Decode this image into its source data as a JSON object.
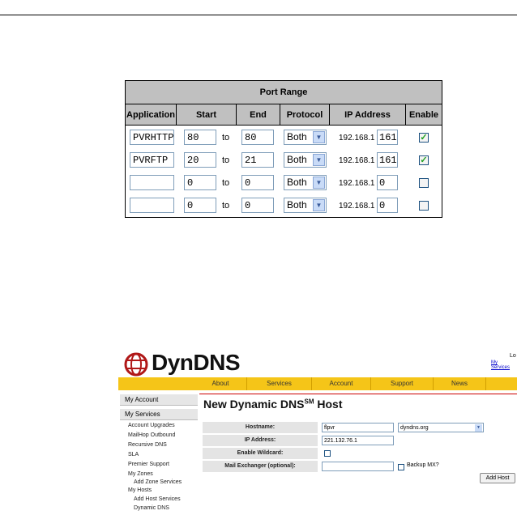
{
  "port_range": {
    "title": "Port Range",
    "columns": [
      "Application",
      "Start",
      "End",
      "Protocol",
      "IP Address",
      "Enable"
    ],
    "to_label": "to",
    "rows": [
      {
        "application": "PVRHTTP",
        "start": "80",
        "end": "80",
        "protocol": "Both",
        "ip_prefix": "192.168.1",
        "ip_last": "161",
        "enabled": true
      },
      {
        "application": "PVRFTP",
        "start": "20",
        "end": "21",
        "protocol": "Both",
        "ip_prefix": "192.168.1",
        "ip_last": "161",
        "enabled": true
      },
      {
        "application": "",
        "start": "0",
        "end": "0",
        "protocol": "Both",
        "ip_prefix": "192.168.1",
        "ip_last": "0",
        "enabled": false
      },
      {
        "application": "",
        "start": "0",
        "end": "0",
        "protocol": "Both",
        "ip_prefix": "192.168.1",
        "ip_last": "0",
        "enabled": false
      }
    ]
  },
  "dyndns": {
    "logo_text": "DynDNS",
    "top_right_1": "Lo",
    "top_right_2": "My Services",
    "nav": [
      "About",
      "Services",
      "Account",
      "Support",
      "News"
    ],
    "sidebar": {
      "head1": "My Account",
      "head2": "My Services",
      "items": [
        "Account Upgrades",
        "MailHop Outbound",
        "Recursive DNS",
        "SLA",
        "Premier Support",
        "My Zones",
        "Add Zone Services",
        "My Hosts",
        "Add Host Services",
        "Dynamic DNS"
      ]
    },
    "page_title": "New Dynamic DNS",
    "page_title_sup": "SM",
    "page_title_suffix": " Host",
    "form": {
      "hostname_label": "Hostname:",
      "hostname_value": "flpvr",
      "domain_value": "dyndns.org",
      "ip_label": "IP Address:",
      "ip_value": "221.132.76.1",
      "wildcard_label": "Enable Wildcard:",
      "mx_label": "Mail Exchanger (optional):",
      "mx_value": "",
      "backup_mx_label": "Backup MX?",
      "add_button": "Add Host"
    }
  }
}
